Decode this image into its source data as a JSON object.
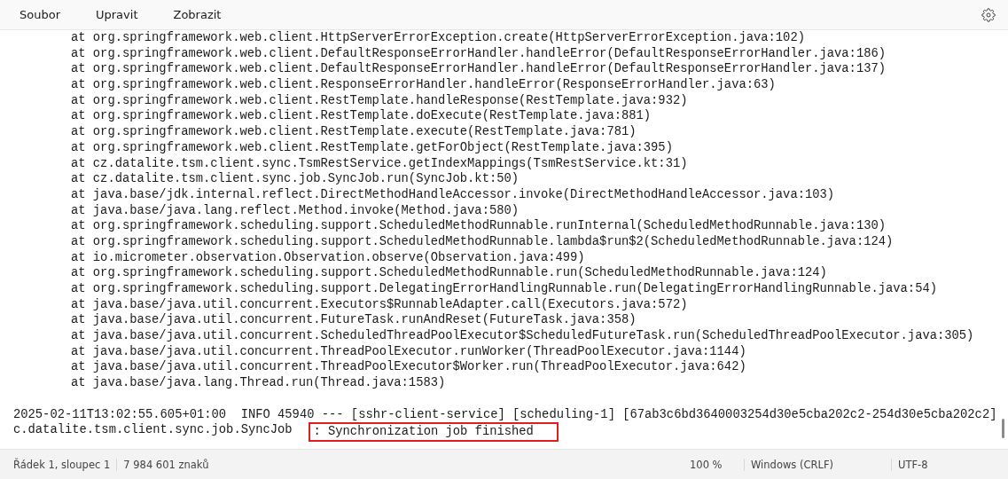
{
  "menu": [
    {
      "label": "Soubor"
    },
    {
      "label": "Upravit"
    },
    {
      "label": "Zobrazit"
    }
  ],
  "editor": {
    "lines": [
      {
        "kind": "frame",
        "text": "at org.springframework.web.client.HttpServerErrorException.create(HttpServerErrorException.java:102)"
      },
      {
        "kind": "frame",
        "text": "at org.springframework.web.client.DefaultResponseErrorHandler.handleError(DefaultResponseErrorHandler.java:186)"
      },
      {
        "kind": "frame",
        "text": "at org.springframework.web.client.DefaultResponseErrorHandler.handleError(DefaultResponseErrorHandler.java:137)"
      },
      {
        "kind": "frame",
        "text": "at org.springframework.web.client.ResponseErrorHandler.handleError(ResponseErrorHandler.java:63)"
      },
      {
        "kind": "frame",
        "text": "at org.springframework.web.client.RestTemplate.handleResponse(RestTemplate.java:932)"
      },
      {
        "kind": "frame",
        "text": "at org.springframework.web.client.RestTemplate.doExecute(RestTemplate.java:881)"
      },
      {
        "kind": "frame",
        "text": "at org.springframework.web.client.RestTemplate.execute(RestTemplate.java:781)"
      },
      {
        "kind": "frame",
        "text": "at org.springframework.web.client.RestTemplate.getForObject(RestTemplate.java:395)"
      },
      {
        "kind": "frame",
        "text": "at cz.datalite.tsm.client.sync.TsmRestService.getIndexMappings(TsmRestService.kt:31)"
      },
      {
        "kind": "frame",
        "text": "at cz.datalite.tsm.client.sync.job.SyncJob.run(SyncJob.kt:50)"
      },
      {
        "kind": "frame",
        "text": "at java.base/jdk.internal.reflect.DirectMethodHandleAccessor.invoke(DirectMethodHandleAccessor.java:103)"
      },
      {
        "kind": "frame",
        "text": "at java.base/java.lang.reflect.Method.invoke(Method.java:580)"
      },
      {
        "kind": "frame",
        "text": "at org.springframework.scheduling.support.ScheduledMethodRunnable.runInternal(ScheduledMethodRunnable.java:130)"
      },
      {
        "kind": "frame",
        "text": "at org.springframework.scheduling.support.ScheduledMethodRunnable.lambda$run$2(ScheduledMethodRunnable.java:124)"
      },
      {
        "kind": "frame",
        "text": "at io.micrometer.observation.Observation.observe(Observation.java:499)"
      },
      {
        "kind": "frame",
        "text": "at org.springframework.scheduling.support.ScheduledMethodRunnable.run(ScheduledMethodRunnable.java:124)"
      },
      {
        "kind": "frame",
        "text": "at org.springframework.scheduling.support.DelegatingErrorHandlingRunnable.run(DelegatingErrorHandlingRunnable.java:54)"
      },
      {
        "kind": "frame",
        "text": "at java.base/java.util.concurrent.Executors$RunnableAdapter.call(Executors.java:572)"
      },
      {
        "kind": "frame",
        "text": "at java.base/java.util.concurrent.FutureTask.runAndReset(FutureTask.java:358)"
      },
      {
        "kind": "frame",
        "text": "at java.base/java.util.concurrent.ScheduledThreadPoolExecutor$ScheduledFutureTask.run(ScheduledThreadPoolExecutor.java:305)"
      },
      {
        "kind": "frame",
        "text": "at java.base/java.util.concurrent.ThreadPoolExecutor.runWorker(ThreadPoolExecutor.java:1144)"
      },
      {
        "kind": "frame",
        "text": "at java.base/java.util.concurrent.ThreadPoolExecutor$Worker.run(ThreadPoolExecutor.java:642)"
      },
      {
        "kind": "frame",
        "text": "at java.base/java.lang.Thread.run(Thread.java:1583)"
      },
      {
        "kind": "blank"
      },
      {
        "kind": "log",
        "text": "2025-02-11T13:02:55.605+01:00  INFO 45940 --- [sshr-client-service] [scheduling-1] [67ab3c6bd3640003254d30e5cba202c2-254d30e5cba202c2]"
      },
      {
        "kind": "log",
        "text": "c.datalite.tsm.client.sync.job.SyncJob   ",
        "highlight": ": Synchronization job finished"
      }
    ]
  },
  "status_bar": {
    "position": "Řádek 1, sloupec 1",
    "chars": "7 984 601 znaků",
    "zoom": "100 %",
    "line_ending": "Windows (CRLF)",
    "encoding": "UTF-8"
  }
}
